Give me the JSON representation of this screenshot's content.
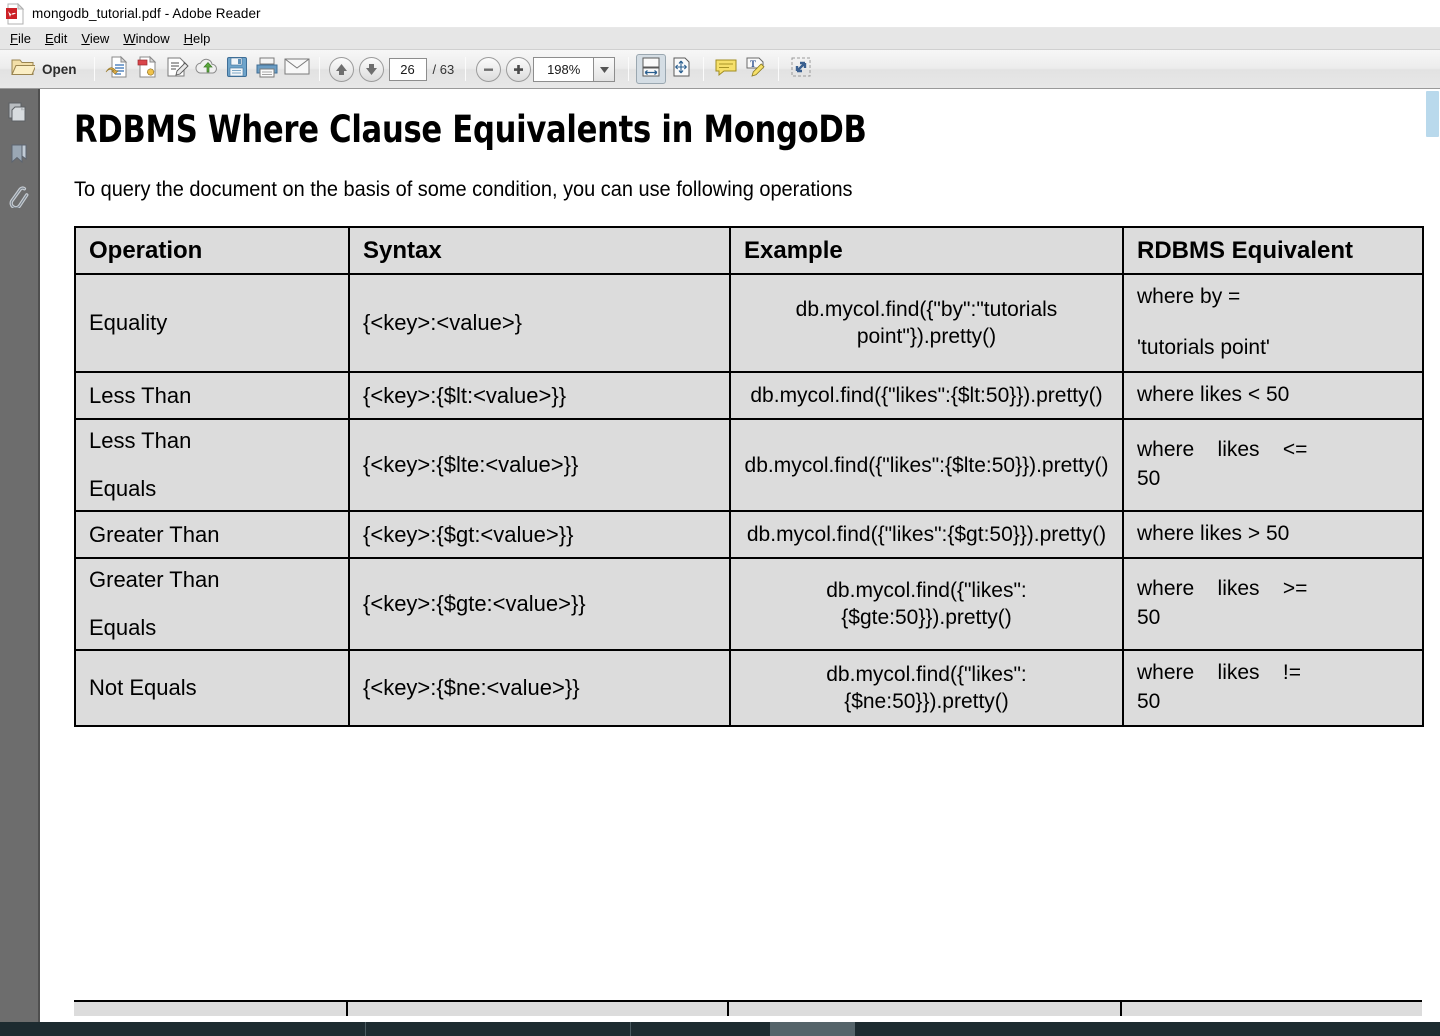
{
  "window": {
    "title": "mongodb_tutorial.pdf - Adobe Reader",
    "app_icon": "pdf-document-icon"
  },
  "menubar": {
    "items": [
      {
        "label": "File",
        "mnemonic": "F"
      },
      {
        "label": "Edit",
        "mnemonic": "E"
      },
      {
        "label": "View",
        "mnemonic": "V"
      },
      {
        "label": "Window",
        "mnemonic": "W"
      },
      {
        "label": "Help",
        "mnemonic": "H"
      }
    ]
  },
  "toolbar": {
    "open_label": "Open",
    "open_icon": "folder-open-icon",
    "icons": [
      "create-pdf-icon",
      "combine-files-icon",
      "edit-pdf-icon",
      "upload-to-cloud-icon",
      "save-icon",
      "print-icon",
      "email-icon",
      "previous-page-icon",
      "next-page-icon",
      "zoom-out-icon",
      "zoom-in-icon",
      "fit-width-icon",
      "fit-page-icon",
      "sticky-note-icon",
      "highlight-text-icon",
      "read-mode-icon"
    ],
    "page_current": "26",
    "page_total": "/ 63",
    "zoom_value": "198%",
    "zoom_dropdown_icon": "chevron-down-icon"
  },
  "navpane": {
    "items": [
      {
        "name": "page-thumbnails",
        "icon": "page-thumbnails-icon"
      },
      {
        "name": "bookmarks",
        "icon": "bookmark-icon"
      },
      {
        "name": "attachments",
        "icon": "paperclip-icon"
      }
    ]
  },
  "document": {
    "title": "RDBMS Where Clause Equivalents in MongoDB",
    "intro": "To query the document on the basis of some condition, you can use following operations",
    "table": {
      "headers": [
        "Operation",
        "Syntax",
        "Example",
        "RDBMS Equivalent"
      ],
      "rows": [
        {
          "operation": "Equality",
          "syntax": "{<key>:<value>}",
          "example": "db.mycol.find({\"by\":\"tutorials point\"}).pretty()",
          "rdbms_line1": "where by =",
          "rdbms_line2": "'tutorials point'",
          "rdbms_justified": false
        },
        {
          "operation": "Less Than",
          "syntax": "{<key>:{$lt:<value>}}",
          "example": "db.mycol.find({\"likes\":{$lt:50}}).pretty()",
          "rdbms_line1": "where likes < 50",
          "rdbms_line2": "",
          "rdbms_justified": false
        },
        {
          "operation": "Less Than Equals",
          "syntax": "{<key>:{$lte:<value>}}",
          "example": "db.mycol.find({\"likes\":{$lte:50}}).pretty()",
          "rdbms_line1": "where likes <=",
          "rdbms_line2": "50",
          "rdbms_justified": true
        },
        {
          "operation": "Greater Than",
          "syntax": "{<key>:{$gt:<value>}}",
          "example": "db.mycol.find({\"likes\":{$gt:50}}).pretty()",
          "rdbms_line1": "where likes > 50",
          "rdbms_line2": "",
          "rdbms_justified": false
        },
        {
          "operation": "Greater Than Equals",
          "syntax": "{<key>:{$gte:<value>}}",
          "example": "db.mycol.find({\"likes\":{$gte:50}}).pretty()",
          "rdbms_line1": "where likes >=",
          "rdbms_line2": "50",
          "rdbms_justified": true
        },
        {
          "operation": "Not Equals",
          "syntax": "{<key>:{$ne:<value>}}",
          "example": "db.mycol.find({\"likes\":{$ne:50}}).pretty()",
          "rdbms_line1": "where likes !=",
          "rdbms_line2": "50",
          "rdbms_justified": true
        }
      ]
    }
  },
  "colors": {
    "table_fill": "#dcdcdc",
    "navpane": "#6d6d6d",
    "scrollbar_thumb": "#b9d9ec",
    "taskbar": "#1d2b30"
  }
}
